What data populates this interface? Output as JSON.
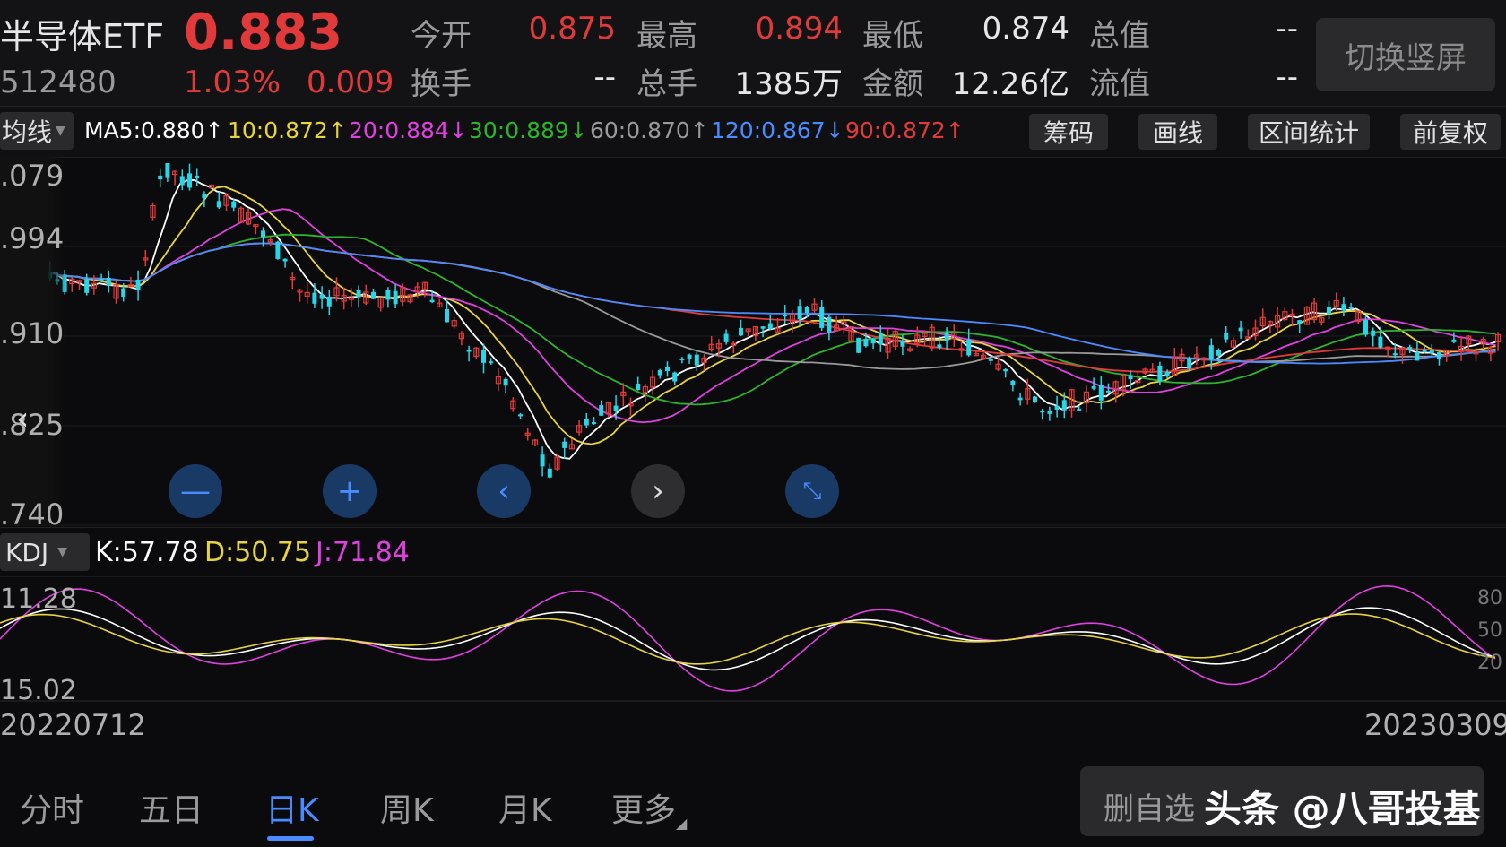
{
  "quote": {
    "name": "半导体ETF",
    "code": "512480",
    "price": "0.883",
    "change_pct": "1.03%",
    "change": "0.009",
    "open_label": "今开",
    "open": "0.875",
    "high_label": "最高",
    "high": "0.894",
    "low_label": "最低",
    "low": "0.874",
    "total_value_label": "总值",
    "total_value": "--",
    "turnover_label": "换手",
    "turnover": "--",
    "total_vol_label": "总手",
    "total_vol": "1385万",
    "amount_label": "金额",
    "amount": "12.26亿",
    "float_value_label": "流值",
    "float_value": "--",
    "switch_label": "切换竖屏"
  },
  "ma_bar": {
    "selector": "均线",
    "ma5": "MA5:0.880↑",
    "ma10": "10:0.872↑",
    "ma20": "20:0.884↓",
    "ma30": "30:0.889↓",
    "ma60": "60:0.870↑",
    "ma120": "120:0.867↓",
    "ma90": "90:0.872↑",
    "buttons": [
      "筹码",
      "画线",
      "区间统计",
      "前复权"
    ]
  },
  "price_axis": [
    ".079",
    ".994",
    ".910",
    ".825",
    ".740"
  ],
  "kdj": {
    "selector": "KDJ",
    "k": "K:57.78",
    "d": "D:50.75",
    "j": "J:71.84",
    "axis_top": "11.28",
    "axis_bottom": "15.02",
    "right_ticks": [
      "80",
      "50",
      "20"
    ]
  },
  "dates": {
    "start": "20220712",
    "end": "20230309"
  },
  "tabs": [
    "分时",
    "五日",
    "日K",
    "周K",
    "月K",
    "更多"
  ],
  "active_tab": "日K",
  "bottom": {
    "remove_label": "删自选",
    "watermark": "头条 @八哥投基"
  },
  "colors": {
    "up": "#e23a3a",
    "down": "#27d6e8",
    "ma5": "#ffffff",
    "ma10": "#e8d53a",
    "ma20": "#e040e0",
    "ma30": "#2cb52c",
    "ma60": "#9a9a9a",
    "ma120": "#4a8cff",
    "ma90": "#e23a3a"
  }
}
